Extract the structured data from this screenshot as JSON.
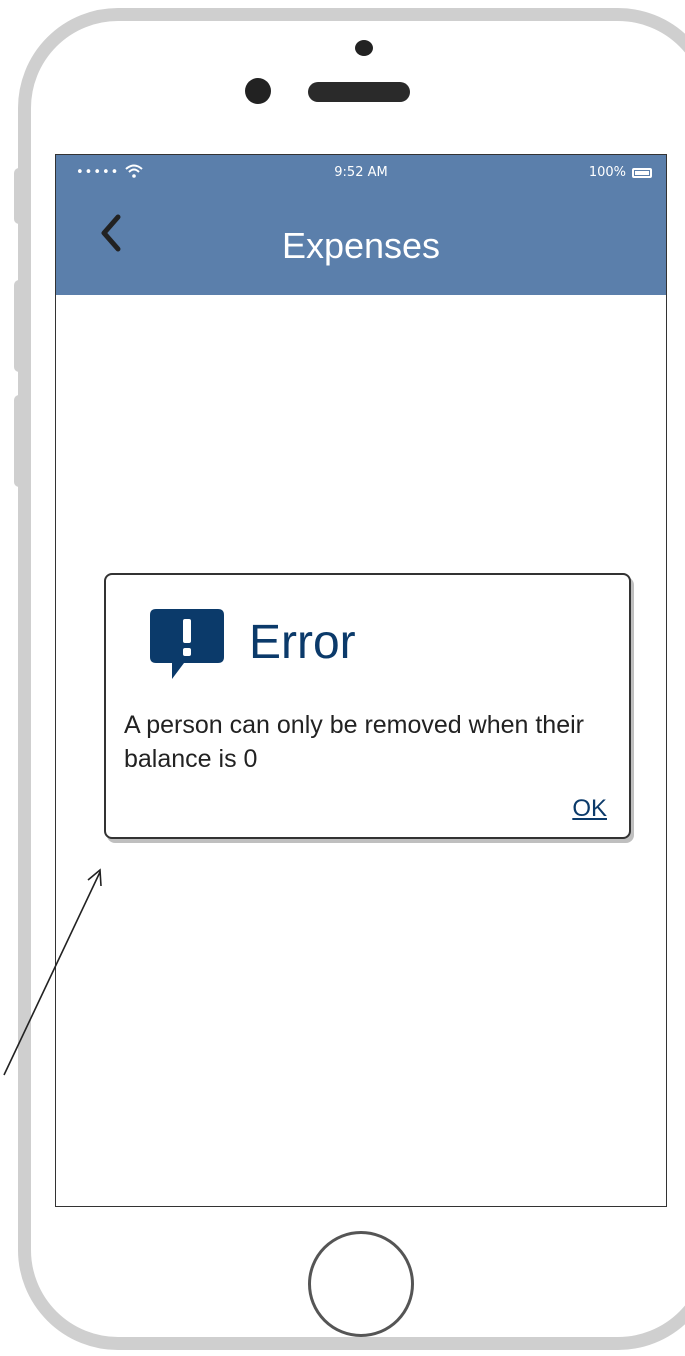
{
  "status_bar": {
    "signal": "••••• ",
    "time": "9:52 AM",
    "battery": "100%"
  },
  "nav": {
    "back_icon": "chevron-left-icon",
    "title": "Expenses"
  },
  "dialog": {
    "icon": "exclamation-speech-bubble-icon",
    "title": "Error",
    "message": "A person can only be removed when their balance is 0",
    "ok_label": "OK"
  },
  "colors": {
    "nav_bar": "#5b7fab",
    "accent": "#0b3a6a",
    "phone_frame": "#cfcfcf"
  }
}
